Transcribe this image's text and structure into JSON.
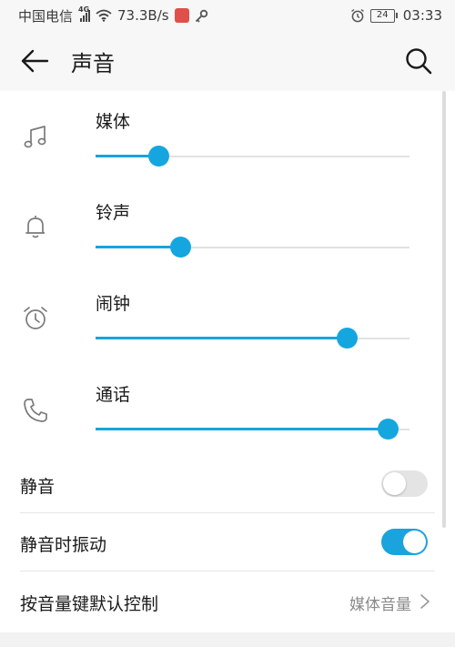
{
  "status_bar": {
    "carrier": "中国电信",
    "network_type": "4G",
    "speed": "73.3B/s",
    "battery": "24",
    "time": "03:33"
  },
  "header": {
    "title": "声音"
  },
  "volumes": [
    {
      "label": "媒体",
      "icon": "music-note-icon",
      "level": 0.2
    },
    {
      "label": "铃声",
      "icon": "bell-icon",
      "level": 0.27
    },
    {
      "label": "闹钟",
      "icon": "alarm-clock-icon",
      "level": 0.8
    },
    {
      "label": "通话",
      "icon": "phone-icon",
      "level": 0.93
    }
  ],
  "settings": {
    "mute_label": "静音",
    "mute_on": false,
    "vibrate_label": "静音时振动",
    "vibrate_on": true,
    "volume_key_label": "按音量键默认控制",
    "volume_key_value": "媒体音量"
  },
  "colors": {
    "accent": "#1aa3dd",
    "track": "#e2e2e2"
  }
}
